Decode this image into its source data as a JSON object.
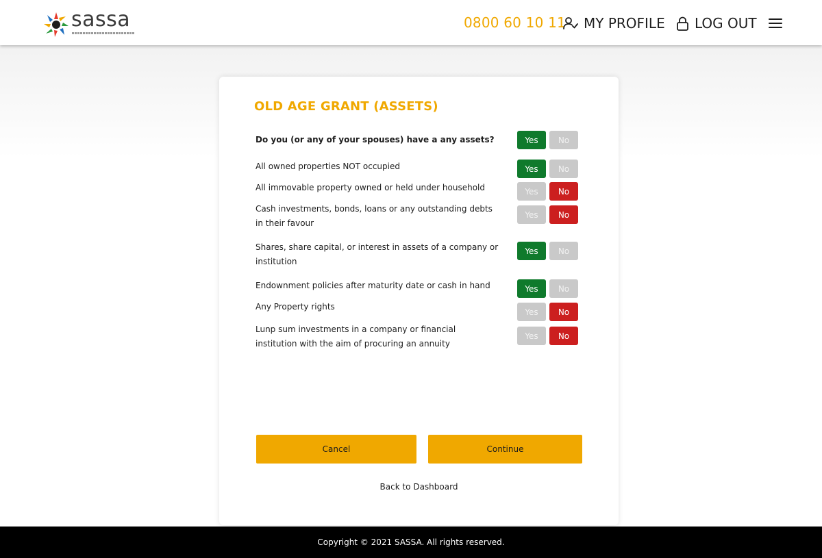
{
  "header": {
    "logo_text": "sassa",
    "logo_tagline": "SOUTH AFRICAN SOCIAL SECURITY AGENCY",
    "phone": "0800 60 10 11",
    "profile_label": "MY PROFILE",
    "logout_label": "LOG OUT"
  },
  "card": {
    "title": "OLD AGE GRANT (ASSETS)",
    "questions": [
      {
        "text": "Do you (or any of your spouses) have a any assets?",
        "answer": "Yes"
      },
      {
        "text": "All owned properties NOT occupied",
        "answer": "Yes"
      },
      {
        "text": "All immovable property owned or held under household",
        "answer": "No"
      },
      {
        "text": "Cash investments, bonds,  loans or any outstanding debts in their favour",
        "answer": "No"
      },
      {
        "text": "Shares, share capital, or interest in assets of a company or institution",
        "answer": "Yes"
      },
      {
        "text": "Endownment policies after maturity date or cash in hand",
        "answer": "Yes"
      },
      {
        "text": "Any Property rights",
        "answer": "No"
      },
      {
        "text": "Lunp sum investments in a company or financial institution with the aim of procuring an annuity",
        "answer": "No"
      }
    ],
    "yes_label": "Yes",
    "no_label": "No",
    "cancel_label": "Cancel",
    "continue_label": "Continue",
    "back_label": "Back to Dashboard"
  },
  "footer": {
    "copyright": "Copyright © 2021 SASSA. All rights reserved."
  },
  "colors": {
    "accent": "#f0a800",
    "yes_active": "#0f7a2c",
    "no_active": "#cc1f1f",
    "inactive": "#c9c9c9"
  },
  "icons": {
    "profile": "user-check-icon",
    "logout": "lock-icon",
    "menu": "hamburger-menu-icon"
  }
}
